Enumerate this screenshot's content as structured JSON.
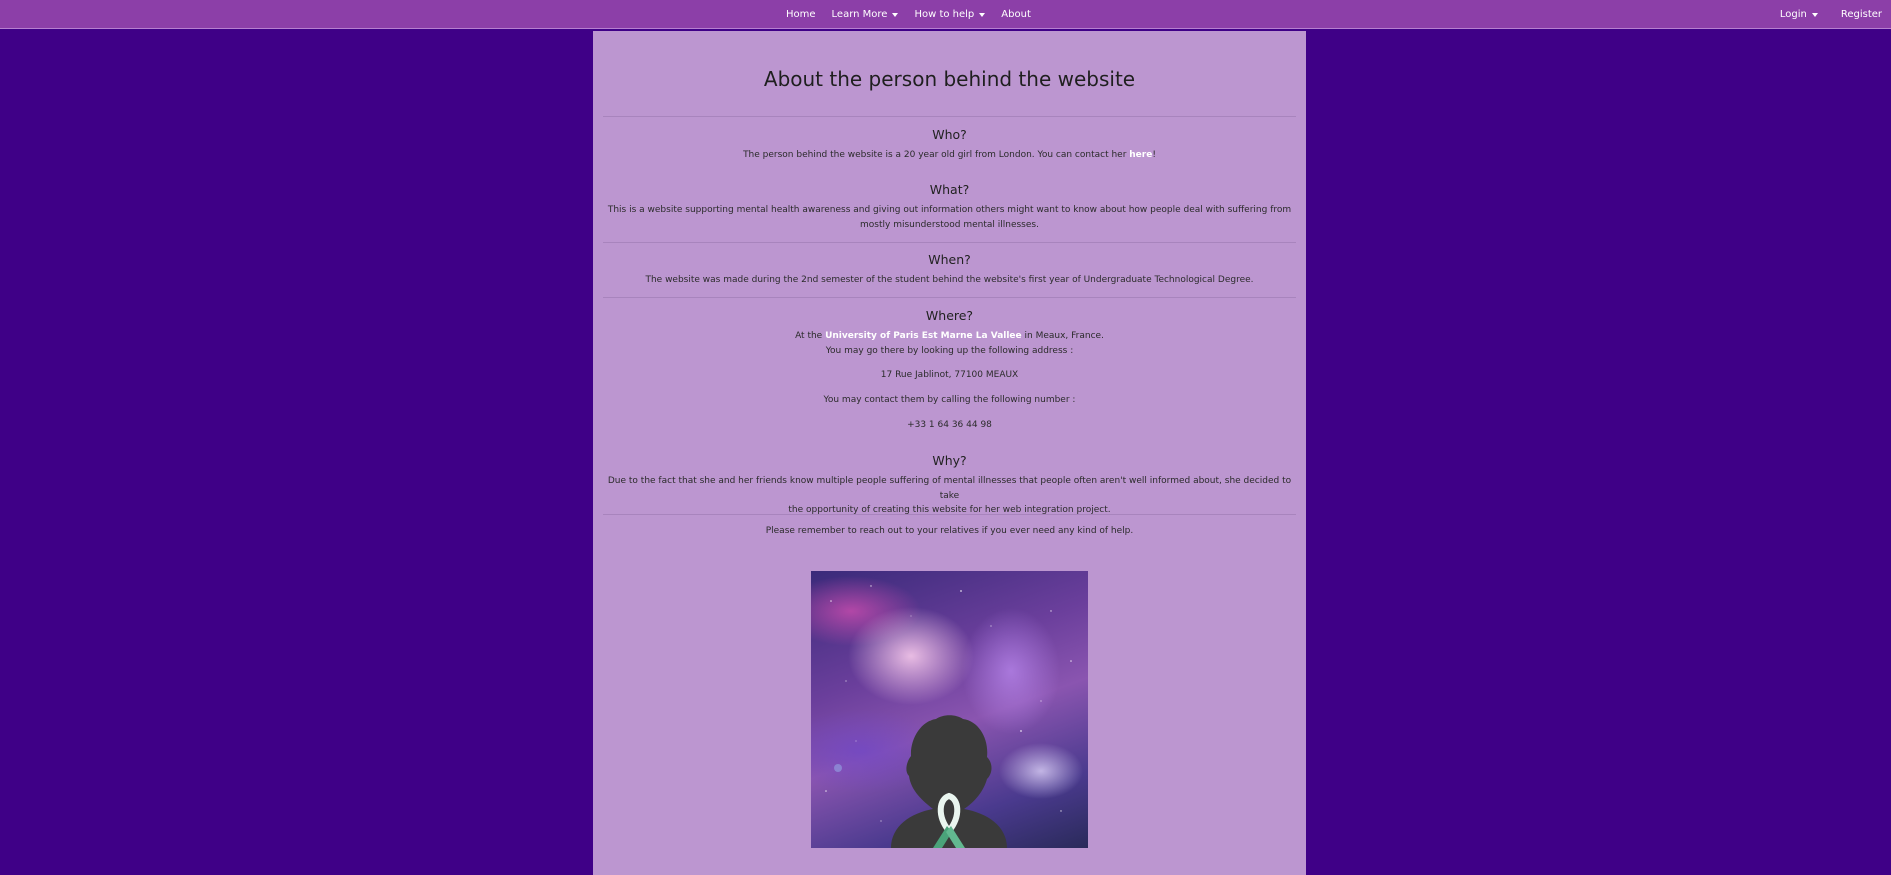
{
  "nav": {
    "items": [
      {
        "label": "Home",
        "dropdown": false
      },
      {
        "label": "Learn More",
        "dropdown": true
      },
      {
        "label": "How to help",
        "dropdown": true
      },
      {
        "label": "About",
        "dropdown": false
      }
    ],
    "login_label": "Login",
    "register_label": "Register"
  },
  "page": {
    "title": "About the person behind the website",
    "who": {
      "heading": "Who?",
      "text_before": "The person behind the website is a 20 year old girl from London. You can contact her ",
      "link_text": "here",
      "text_after": "!"
    },
    "what": {
      "heading": "What?",
      "line1": "This is a website supporting mental health awareness and giving out information others might want to know about how people deal with suffering from",
      "line2": "mostly misunderstood mental illnesses."
    },
    "when": {
      "heading": "When?",
      "text": "The website was made during the 2nd semester of the student behind the website's first year of Undergraduate Technological Degree."
    },
    "where": {
      "heading": "Where?",
      "text_before": "At the ",
      "link_text": "University of Paris Est Marne La Vallee",
      "text_after": " in Meaux, France.",
      "address_intro": "You may go there by looking up the following address :",
      "address": "17 Rue Jablinot, 77100 MEAUX",
      "phone_intro": "You may contact them by calling the following number :",
      "phone": "+33 1 64 36 44 98"
    },
    "why": {
      "heading": "Why?",
      "line1": "Due to the fact that she and her friends know multiple people suffering of mental illnesses that people often aren't well informed about, she decided to take",
      "line2": "the opportunity of creating this website for her web integration project."
    },
    "closing": "Please remember to reach out to your relatives if you ever need any kind of help."
  },
  "colors": {
    "background": "#3f0087",
    "navbar": "#8c3fa8",
    "container": "#bc96d0",
    "link": "#ffffff"
  }
}
